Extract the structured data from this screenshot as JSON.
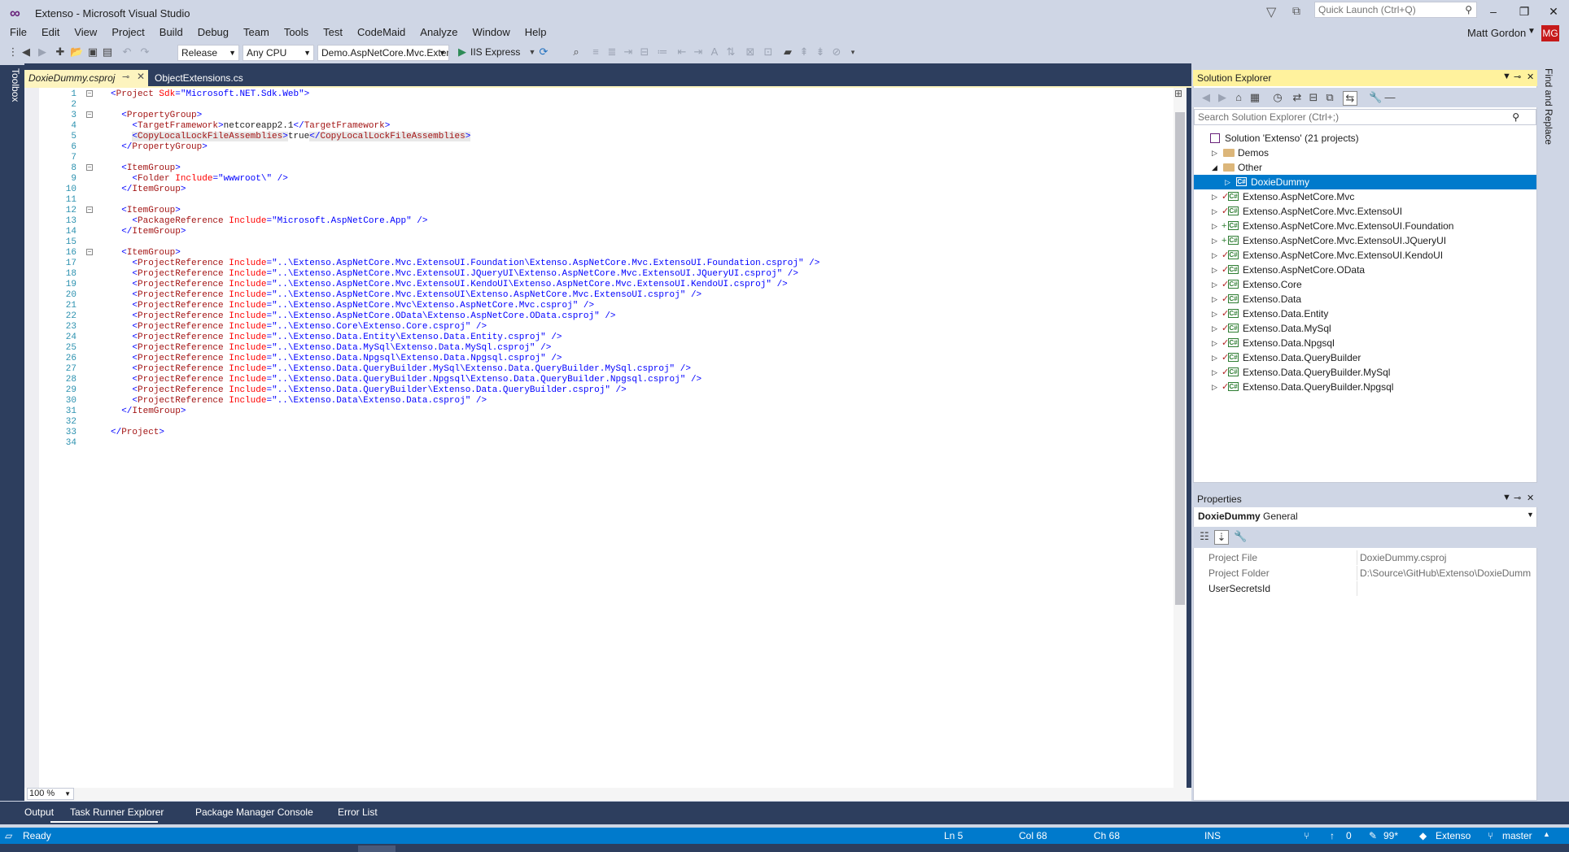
{
  "window": {
    "title": "Extenso - Microsoft Visual Studio",
    "quick_launch_placeholder": "Quick Launch (Ctrl+Q)",
    "user_name": "Matt Gordon",
    "avatar_initials": "MG",
    "logo_icon": "visual-studio-logo",
    "controls": [
      "minimize",
      "restore",
      "close"
    ]
  },
  "menu": [
    "File",
    "Edit",
    "View",
    "Project",
    "Build",
    "Debug",
    "Team",
    "Tools",
    "Test",
    "CodeMaid",
    "Analyze",
    "Window",
    "Help"
  ],
  "toolbar": {
    "configuration": "Release",
    "platform": "Any CPU",
    "startup_project": "Demo.AspNetCore.Mvc.ExtensoUI.",
    "run_target": "IIS Express"
  },
  "toolbox_label": "Toolbox",
  "find_replace_label": "Find and Replace",
  "tabs": {
    "active": "DoxieDummy.csproj",
    "inactive": "ObjectExtensions.cs"
  },
  "editor": {
    "zoom": "100 %",
    "lines": [
      {
        "n": "1",
        "tokens": [
          [
            "b",
            "<"
          ],
          [
            "m",
            "Project"
          ],
          [
            "a",
            " Sdk"
          ],
          [
            "b",
            "="
          ],
          [
            "b",
            "\"Microsoft.NET.Sdk.Web\""
          ],
          [
            "b",
            ">"
          ]
        ],
        "fold": "-"
      },
      {
        "n": "2",
        "tokens": []
      },
      {
        "n": "3",
        "tokens": [
          [
            "k",
            "  "
          ],
          [
            "b",
            "<"
          ],
          [
            "m",
            "PropertyGroup"
          ],
          [
            "b",
            ">"
          ]
        ],
        "fold": "-"
      },
      {
        "n": "4",
        "tokens": [
          [
            "k",
            "    "
          ],
          [
            "b",
            "<"
          ],
          [
            "m",
            "TargetFramework"
          ],
          [
            "b",
            ">"
          ],
          [
            "k",
            "netcoreapp2.1"
          ],
          [
            "b",
            "</"
          ],
          [
            "m",
            "TargetFramework"
          ],
          [
            "b",
            ">"
          ]
        ]
      },
      {
        "n": "5",
        "tokens": [
          [
            "k",
            "    "
          ],
          [
            "b",
            "<"
          ],
          [
            "m",
            "CopyLocalLockFileAssemblies"
          ],
          [
            "b",
            ">"
          ],
          [
            "k",
            "true"
          ],
          [
            "b",
            "</"
          ],
          [
            "m",
            "CopyLocalLockFileAssemblies"
          ],
          [
            "b",
            ">"
          ]
        ],
        "highlight": true
      },
      {
        "n": "6",
        "tokens": [
          [
            "k",
            "  "
          ],
          [
            "b",
            "</"
          ],
          [
            "m",
            "PropertyGroup"
          ],
          [
            "b",
            ">"
          ]
        ]
      },
      {
        "n": "7",
        "tokens": []
      },
      {
        "n": "8",
        "tokens": [
          [
            "k",
            "  "
          ],
          [
            "b",
            "<"
          ],
          [
            "m",
            "ItemGroup"
          ],
          [
            "b",
            ">"
          ]
        ],
        "fold": "-"
      },
      {
        "n": "9",
        "tokens": [
          [
            "k",
            "    "
          ],
          [
            "b",
            "<"
          ],
          [
            "m",
            "Folder"
          ],
          [
            "a",
            " Include"
          ],
          [
            "b",
            "="
          ],
          [
            "b",
            "\"wwwroot\\\""
          ],
          [
            "b",
            " />"
          ]
        ]
      },
      {
        "n": "10",
        "tokens": [
          [
            "k",
            "  "
          ],
          [
            "b",
            "</"
          ],
          [
            "m",
            "ItemGroup"
          ],
          [
            "b",
            ">"
          ]
        ]
      },
      {
        "n": "11",
        "tokens": []
      },
      {
        "n": "12",
        "tokens": [
          [
            "k",
            "  "
          ],
          [
            "b",
            "<"
          ],
          [
            "m",
            "ItemGroup"
          ],
          [
            "b",
            ">"
          ]
        ],
        "fold": "-"
      },
      {
        "n": "13",
        "tokens": [
          [
            "k",
            "    "
          ],
          [
            "b",
            "<"
          ],
          [
            "m",
            "PackageReference"
          ],
          [
            "a",
            " Include"
          ],
          [
            "b",
            "="
          ],
          [
            "b",
            "\"Microsoft.AspNetCore.App\""
          ],
          [
            "b",
            " />"
          ]
        ]
      },
      {
        "n": "14",
        "tokens": [
          [
            "k",
            "  "
          ],
          [
            "b",
            "</"
          ],
          [
            "m",
            "ItemGroup"
          ],
          [
            "b",
            ">"
          ]
        ]
      },
      {
        "n": "15",
        "tokens": []
      },
      {
        "n": "16",
        "tokens": [
          [
            "k",
            "  "
          ],
          [
            "b",
            "<"
          ],
          [
            "m",
            "ItemGroup"
          ],
          [
            "b",
            ">"
          ]
        ],
        "fold": "-"
      },
      {
        "n": "17",
        "tokens": [
          [
            "k",
            "    "
          ],
          [
            "b",
            "<"
          ],
          [
            "m",
            "ProjectReference"
          ],
          [
            "a",
            " Include"
          ],
          [
            "b",
            "="
          ],
          [
            "b",
            "\"..\\Extenso.AspNetCore.Mvc.ExtensoUI.Foundation\\Extenso.AspNetCore.Mvc.ExtensoUI.Foundation.csproj\""
          ],
          [
            "b",
            " />"
          ]
        ]
      },
      {
        "n": "18",
        "tokens": [
          [
            "k",
            "    "
          ],
          [
            "b",
            "<"
          ],
          [
            "m",
            "ProjectReference"
          ],
          [
            "a",
            " Include"
          ],
          [
            "b",
            "="
          ],
          [
            "b",
            "\"..\\Extenso.AspNetCore.Mvc.ExtensoUI.JQueryUI\\Extenso.AspNetCore.Mvc.ExtensoUI.JQueryUI.csproj\""
          ],
          [
            "b",
            " />"
          ]
        ]
      },
      {
        "n": "19",
        "tokens": [
          [
            "k",
            "    "
          ],
          [
            "b",
            "<"
          ],
          [
            "m",
            "ProjectReference"
          ],
          [
            "a",
            " Include"
          ],
          [
            "b",
            "="
          ],
          [
            "b",
            "\"..\\Extenso.AspNetCore.Mvc.ExtensoUI.KendoUI\\Extenso.AspNetCore.Mvc.ExtensoUI.KendoUI.csproj\""
          ],
          [
            "b",
            " />"
          ]
        ]
      },
      {
        "n": "20",
        "tokens": [
          [
            "k",
            "    "
          ],
          [
            "b",
            "<"
          ],
          [
            "m",
            "ProjectReference"
          ],
          [
            "a",
            " Include"
          ],
          [
            "b",
            "="
          ],
          [
            "b",
            "\"..\\Extenso.AspNetCore.Mvc.ExtensoUI\\Extenso.AspNetCore.Mvc.ExtensoUI.csproj\""
          ],
          [
            "b",
            " />"
          ]
        ]
      },
      {
        "n": "21",
        "tokens": [
          [
            "k",
            "    "
          ],
          [
            "b",
            "<"
          ],
          [
            "m",
            "ProjectReference"
          ],
          [
            "a",
            " Include"
          ],
          [
            "b",
            "="
          ],
          [
            "b",
            "\"..\\Extenso.AspNetCore.Mvc\\Extenso.AspNetCore.Mvc.csproj\""
          ],
          [
            "b",
            " />"
          ]
        ]
      },
      {
        "n": "22",
        "tokens": [
          [
            "k",
            "    "
          ],
          [
            "b",
            "<"
          ],
          [
            "m",
            "ProjectReference"
          ],
          [
            "a",
            " Include"
          ],
          [
            "b",
            "="
          ],
          [
            "b",
            "\"..\\Extenso.AspNetCore.OData\\Extenso.AspNetCore.OData.csproj\""
          ],
          [
            "b",
            " />"
          ]
        ]
      },
      {
        "n": "23",
        "tokens": [
          [
            "k",
            "    "
          ],
          [
            "b",
            "<"
          ],
          [
            "m",
            "ProjectReference"
          ],
          [
            "a",
            " Include"
          ],
          [
            "b",
            "="
          ],
          [
            "b",
            "\"..\\Extenso.Core\\Extenso.Core.csproj\""
          ],
          [
            "b",
            " />"
          ]
        ]
      },
      {
        "n": "24",
        "tokens": [
          [
            "k",
            "    "
          ],
          [
            "b",
            "<"
          ],
          [
            "m",
            "ProjectReference"
          ],
          [
            "a",
            " Include"
          ],
          [
            "b",
            "="
          ],
          [
            "b",
            "\"..\\Extenso.Data.Entity\\Extenso.Data.Entity.csproj\""
          ],
          [
            "b",
            " />"
          ]
        ]
      },
      {
        "n": "25",
        "tokens": [
          [
            "k",
            "    "
          ],
          [
            "b",
            "<"
          ],
          [
            "m",
            "ProjectReference"
          ],
          [
            "a",
            " Include"
          ],
          [
            "b",
            "="
          ],
          [
            "b",
            "\"..\\Extenso.Data.MySql\\Extenso.Data.MySql.csproj\""
          ],
          [
            "b",
            " />"
          ]
        ]
      },
      {
        "n": "26",
        "tokens": [
          [
            "k",
            "    "
          ],
          [
            "b",
            "<"
          ],
          [
            "m",
            "ProjectReference"
          ],
          [
            "a",
            " Include"
          ],
          [
            "b",
            "="
          ],
          [
            "b",
            "\"..\\Extenso.Data.Npgsql\\Extenso.Data.Npgsql.csproj\""
          ],
          [
            "b",
            " />"
          ]
        ]
      },
      {
        "n": "27",
        "tokens": [
          [
            "k",
            "    "
          ],
          [
            "b",
            "<"
          ],
          [
            "m",
            "ProjectReference"
          ],
          [
            "a",
            " Include"
          ],
          [
            "b",
            "="
          ],
          [
            "b",
            "\"..\\Extenso.Data.QueryBuilder.MySql\\Extenso.Data.QueryBuilder.MySql.csproj\""
          ],
          [
            "b",
            " />"
          ]
        ]
      },
      {
        "n": "28",
        "tokens": [
          [
            "k",
            "    "
          ],
          [
            "b",
            "<"
          ],
          [
            "m",
            "ProjectReference"
          ],
          [
            "a",
            " Include"
          ],
          [
            "b",
            "="
          ],
          [
            "b",
            "\"..\\Extenso.Data.QueryBuilder.Npgsql\\Extenso.Data.QueryBuilder.Npgsql.csproj\""
          ],
          [
            "b",
            " />"
          ]
        ]
      },
      {
        "n": "29",
        "tokens": [
          [
            "k",
            "    "
          ],
          [
            "b",
            "<"
          ],
          [
            "m",
            "ProjectReference"
          ],
          [
            "a",
            " Include"
          ],
          [
            "b",
            "="
          ],
          [
            "b",
            "\"..\\Extenso.Data.QueryBuilder\\Extenso.Data.QueryBuilder.csproj\""
          ],
          [
            "b",
            " />"
          ]
        ]
      },
      {
        "n": "30",
        "tokens": [
          [
            "k",
            "    "
          ],
          [
            "b",
            "<"
          ],
          [
            "m",
            "ProjectReference"
          ],
          [
            "a",
            " Include"
          ],
          [
            "b",
            "="
          ],
          [
            "b",
            "\"..\\Extenso.Data\\Extenso.Data.csproj\""
          ],
          [
            "b",
            " />"
          ]
        ]
      },
      {
        "n": "31",
        "tokens": [
          [
            "k",
            "  "
          ],
          [
            "b",
            "</"
          ],
          [
            "m",
            "ItemGroup"
          ],
          [
            "b",
            ">"
          ]
        ]
      },
      {
        "n": "32",
        "tokens": []
      },
      {
        "n": "33",
        "tokens": [
          [
            "b",
            "</"
          ],
          [
            "m",
            "Project"
          ],
          [
            "b",
            ">"
          ]
        ]
      },
      {
        "n": "34",
        "tokens": []
      }
    ]
  },
  "solution_explorer": {
    "title": "Solution Explorer",
    "search_placeholder": "Search Solution Explorer (Ctrl+;)",
    "tree": [
      {
        "label": "Solution 'Extenso' (21 projects)",
        "kind": "solution",
        "level": 0,
        "exp": ""
      },
      {
        "label": "Demos",
        "kind": "folder",
        "level": 1,
        "exp": "▷"
      },
      {
        "label": "Other",
        "kind": "folder",
        "level": 1,
        "exp": "◢"
      },
      {
        "label": "DoxieDummy",
        "kind": "project-selected",
        "level": 2,
        "exp": "▷",
        "selected": true
      },
      {
        "label": "Extenso.AspNetCore.Mvc",
        "kind": "project",
        "level": 1,
        "exp": "▷",
        "mark": "check"
      },
      {
        "label": "Extenso.AspNetCore.Mvc.ExtensoUI",
        "kind": "project",
        "level": 1,
        "exp": "▷",
        "mark": "check"
      },
      {
        "label": "Extenso.AspNetCore.Mvc.ExtensoUI.Foundation",
        "kind": "project",
        "level": 1,
        "exp": "▷",
        "mark": "plus"
      },
      {
        "label": "Extenso.AspNetCore.Mvc.ExtensoUI.JQueryUI",
        "kind": "project",
        "level": 1,
        "exp": "▷",
        "mark": "plus"
      },
      {
        "label": "Extenso.AspNetCore.Mvc.ExtensoUI.KendoUI",
        "kind": "project",
        "level": 1,
        "exp": "▷",
        "mark": "check"
      },
      {
        "label": "Extenso.AspNetCore.OData",
        "kind": "project",
        "level": 1,
        "exp": "▷",
        "mark": "check"
      },
      {
        "label": "Extenso.Core",
        "kind": "project",
        "level": 1,
        "exp": "▷",
        "mark": "check"
      },
      {
        "label": "Extenso.Data",
        "kind": "project",
        "level": 1,
        "exp": "▷",
        "mark": "check"
      },
      {
        "label": "Extenso.Data.Entity",
        "kind": "project",
        "level": 1,
        "exp": "▷",
        "mark": "check"
      },
      {
        "label": "Extenso.Data.MySql",
        "kind": "project",
        "level": 1,
        "exp": "▷",
        "mark": "check"
      },
      {
        "label": "Extenso.Data.Npgsql",
        "kind": "project",
        "level": 1,
        "exp": "▷",
        "mark": "check"
      },
      {
        "label": "Extenso.Data.QueryBuilder",
        "kind": "project",
        "level": 1,
        "exp": "▷",
        "mark": "check"
      },
      {
        "label": "Extenso.Data.QueryBuilder.MySql",
        "kind": "project",
        "level": 1,
        "exp": "▷",
        "mark": "check"
      },
      {
        "label": "Extenso.Data.QueryBuilder.Npgsql",
        "kind": "project",
        "level": 1,
        "exp": "▷",
        "mark": "check"
      }
    ]
  },
  "properties": {
    "title": "Properties",
    "object_name": "DoxieDummy",
    "object_type": "General",
    "rows": [
      {
        "name": "Project File",
        "value": "DoxieDummy.csproj"
      },
      {
        "name": "Project Folder",
        "value": "D:\\Source\\GitHub\\Extenso\\DoxieDumm"
      },
      {
        "name": "UserSecretsId",
        "value": ""
      }
    ]
  },
  "bottom_tabs": [
    "Output",
    "Task Runner Explorer",
    "Package Manager Console",
    "Error List"
  ],
  "status": {
    "ready": "Ready",
    "line": "Ln 5",
    "col": "Col 68",
    "ch": "Ch 68",
    "ins": "INS",
    "up_count": "0",
    "pending_count": "99*",
    "repo": "Extenso",
    "branch": "master"
  },
  "colors": {
    "accent": "#007acc",
    "xml_bracket": "#0000ff",
    "xml_element": "#a31515",
    "xml_attribute": "#ff0000",
    "frame": "#2d3e5e",
    "chrome": "#cfd6e5"
  }
}
